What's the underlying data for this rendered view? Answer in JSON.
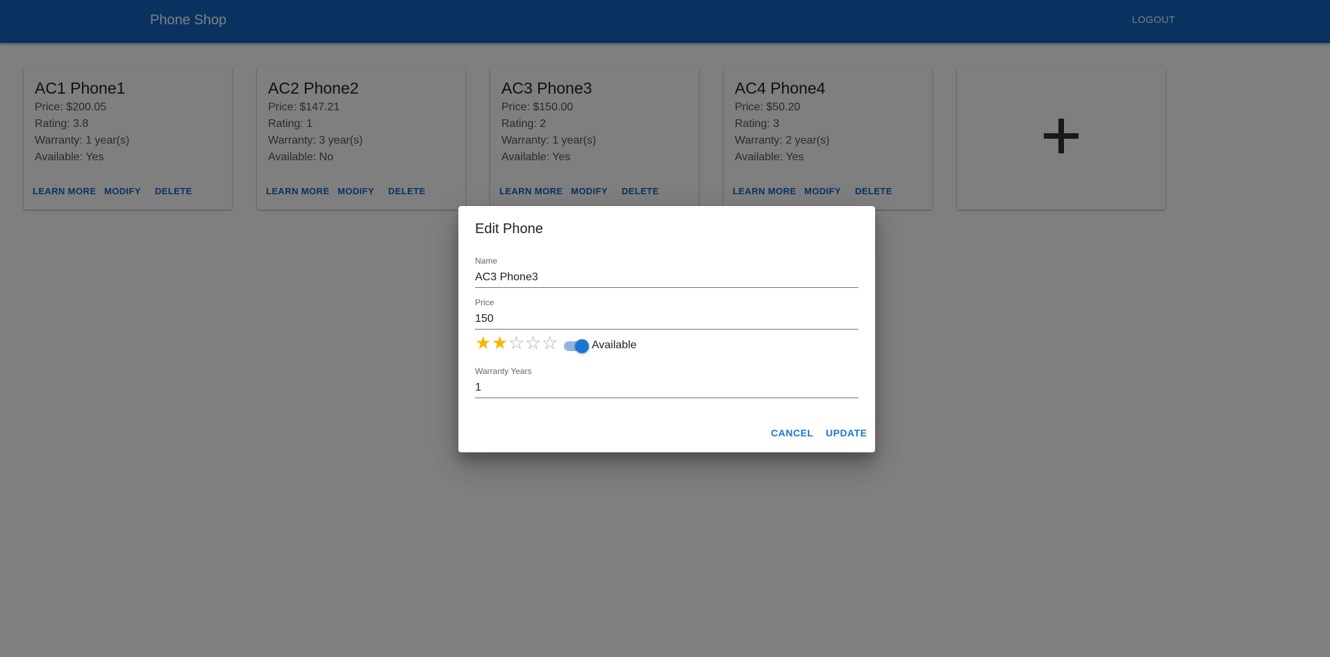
{
  "appbar": {
    "title": "Phone Shop",
    "logout_label": "LOGOUT"
  },
  "cards": [
    {
      "title": "AC1 Phone1",
      "price": "Price: $200.05",
      "rating": "Rating: 3.8",
      "warranty": "Warranty: 1 year(s)",
      "available": "Available: Yes"
    },
    {
      "title": "AC2 Phone2",
      "price": "Price: $147.21",
      "rating": "Rating: 1",
      "warranty": "Warranty: 3 year(s)",
      "available": "Available: No"
    },
    {
      "title": "AC3 Phone3",
      "price": "Price: $150.00",
      "rating": "Rating: 2",
      "warranty": "Warranty: 1 year(s)",
      "available": "Available: Yes"
    },
    {
      "title": "AC4 Phone4",
      "price": "Price: $50.20",
      "rating": "Rating: 3",
      "warranty": "Warranty: 2 year(s)",
      "available": "Available: Yes"
    }
  ],
  "card_actions": {
    "learn_more": "LEARN MORE",
    "modify": "MODIFY",
    "delete": "DELETE"
  },
  "add_card": {
    "icon": "plus-icon"
  },
  "dialog": {
    "title": "Edit Phone",
    "name_label": "Name",
    "name_value": "AC3 Phone3",
    "price_label": "Price",
    "price_value": "150",
    "rating_value": 2,
    "rating_max": 5,
    "available_label": "Available",
    "available_on": true,
    "warranty_label": "Warranty Years",
    "warranty_value": "1",
    "cancel_label": "CANCEL",
    "update_label": "UPDATE"
  },
  "colors": {
    "primary": "#1565c0",
    "star": "#ffb400",
    "backdrop": "rgba(0,0,0,0.5)"
  }
}
